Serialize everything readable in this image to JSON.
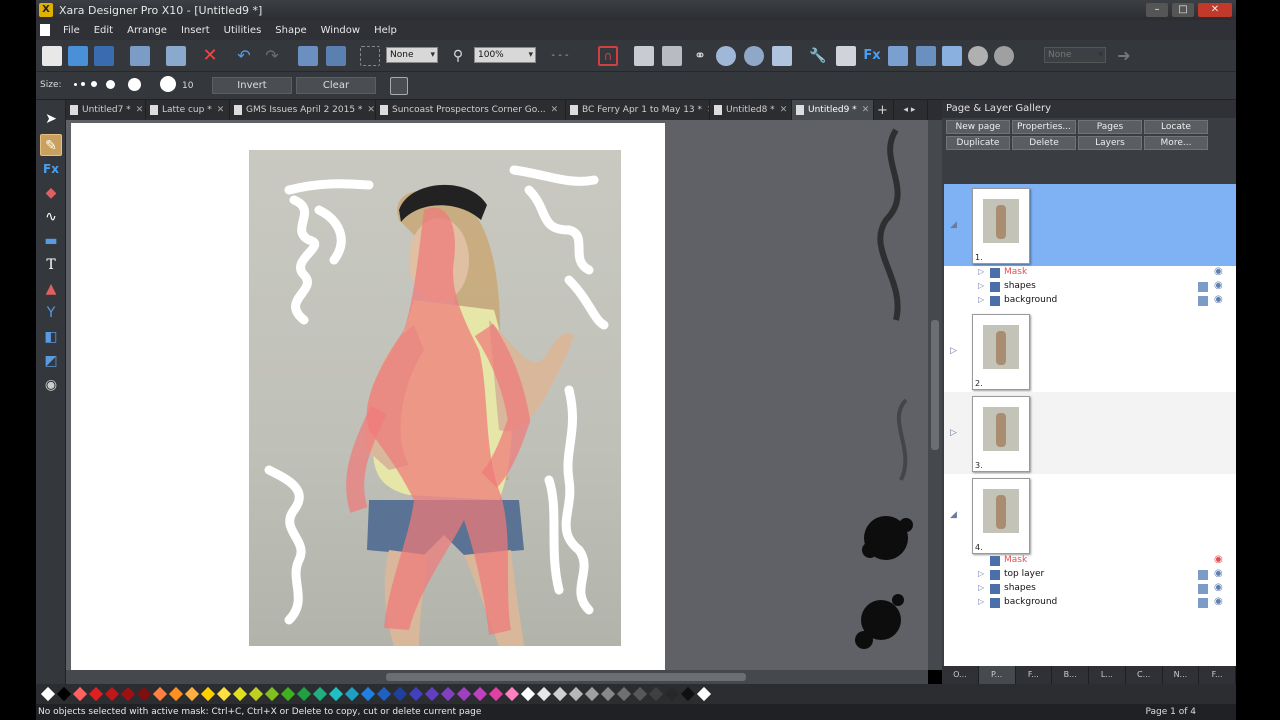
{
  "window": {
    "title": "Xara Designer Pro X10 - [Untitled9 *]"
  },
  "menu": [
    "File",
    "Edit",
    "Arrange",
    "Insert",
    "Utilities",
    "Shape",
    "Window",
    "Help"
  ],
  "toolbar": {
    "quality_value": "None",
    "zoom_value": "100%",
    "disabled_select": "None"
  },
  "brushbar": {
    "size_label": "Size:",
    "size_value": "10",
    "invert_label": "Invert",
    "clear_label": "Clear"
  },
  "doc_tabs": [
    {
      "label": "Untitled7 *",
      "active": false
    },
    {
      "label": "Latte cup *",
      "active": false
    },
    {
      "label": "GMS Issues April 2 2015 *",
      "active": false
    },
    {
      "label": "Suncoast Prospectors Corner Go...",
      "active": false
    },
    {
      "label": "BC Ferry Apr 1 to May 13 *",
      "active": false
    },
    {
      "label": "Untitled8 *",
      "active": false
    },
    {
      "label": "Untitled9 *",
      "active": true
    }
  ],
  "gallery": {
    "title": "Page & Layer Gallery",
    "buttons": [
      "New page",
      "Properties...",
      "Pages",
      "Locate",
      "Duplicate",
      "Delete",
      "Layers",
      "More..."
    ],
    "pages": [
      {
        "number": "1.",
        "selected": true,
        "layers": [
          "Mask",
          "shapes",
          "background"
        ]
      },
      {
        "number": "2.",
        "selected": false,
        "layers": []
      },
      {
        "number": "3.",
        "selected": false,
        "layers": []
      },
      {
        "number": "4.",
        "selected": false,
        "layers": [
          "Mask",
          "top layer",
          "shapes",
          "background"
        ]
      }
    ],
    "bottom_tabs": [
      "O...",
      "P...",
      "F...",
      "B...",
      "L...",
      "C...",
      "N...",
      "F..."
    ]
  },
  "palette_colors": [
    "#ffffff",
    "#000000",
    "#ff6060",
    "#e02020",
    "#c01818",
    "#a01010",
    "#801010",
    "#ff8040",
    "#ff9020",
    "#ffb040",
    "#ffd000",
    "#ffe040",
    "#e0e020",
    "#c0d020",
    "#80c020",
    "#40b020",
    "#20a040",
    "#20b080",
    "#20c0c0",
    "#20a0c0",
    "#2080e0",
    "#2060c0",
    "#2040a0",
    "#4040c0",
    "#6040c0",
    "#8040c0",
    "#a040c0",
    "#c040c0",
    "#e040a0",
    "#ff80c0",
    "#ffffff",
    "#e8e8e8",
    "#d0d0d0",
    "#b8b8b8",
    "#a0a0a0",
    "#888888",
    "#707070",
    "#585858",
    "#404040",
    "#282828",
    "#101010",
    "#ffffff"
  ],
  "status": {
    "message": "No objects selected with active mask: Ctrl+C, Ctrl+X or Delete to copy, cut or delete current page",
    "page_info": "Page 1 of 4"
  }
}
